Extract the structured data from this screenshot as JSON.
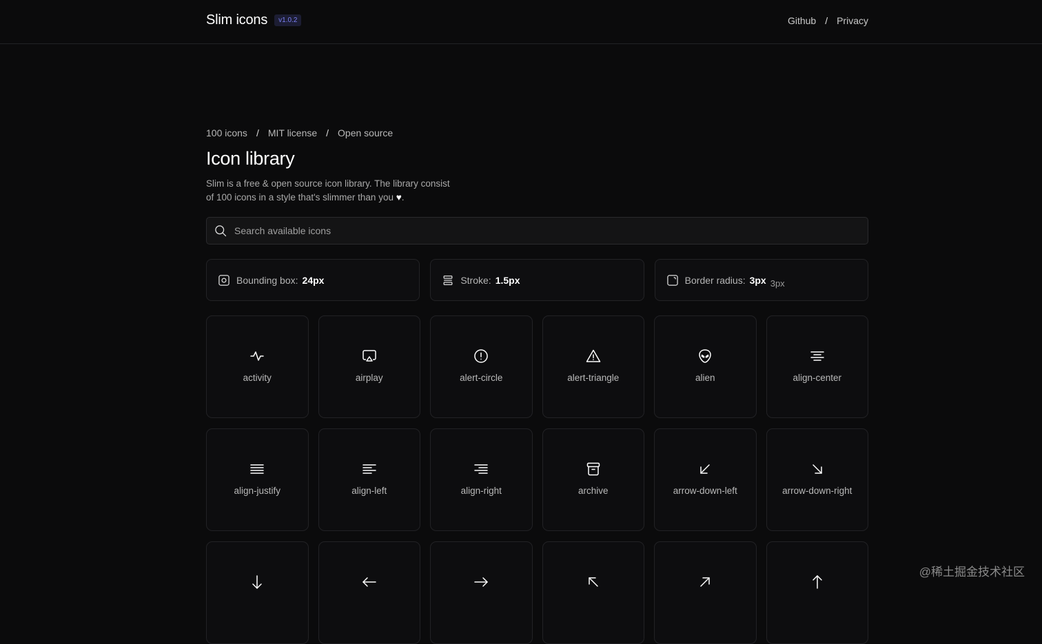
{
  "header": {
    "brand": "Slim icons",
    "version": "v1.0.2",
    "nav": [
      {
        "label": "Github"
      },
      {
        "label": "Privacy"
      }
    ],
    "separator": "/"
  },
  "meta": [
    "100 icons",
    "MIT license",
    "Open source"
  ],
  "title": "Icon library",
  "description_line1": "Slim is a free & open source icon library. The library consist",
  "description_line2": "of 100 icons in a style that's slimmer than you",
  "description_heart": "♥",
  "description_end": ".",
  "search": {
    "placeholder": "Search available icons",
    "value": ""
  },
  "settings": [
    {
      "label": "Bounding box:",
      "value": "24px",
      "extra": "",
      "icon": "bounding-box-icon"
    },
    {
      "label": "Stroke:",
      "value": "1.5px",
      "extra": "",
      "icon": "stroke-icon"
    },
    {
      "label": "Border radius:",
      "value": "3px",
      "extra": "3px",
      "icon": "border-radius-icon"
    }
  ],
  "icons": [
    {
      "label": "activity",
      "icon": "activity-icon"
    },
    {
      "label": "airplay",
      "icon": "airplay-icon"
    },
    {
      "label": "alert-circle",
      "icon": "alert-circle-icon"
    },
    {
      "label": "alert-triangle",
      "icon": "alert-triangle-icon"
    },
    {
      "label": "alien",
      "icon": "alien-icon"
    },
    {
      "label": "align-center",
      "icon": "align-center-icon"
    },
    {
      "label": "align-justify",
      "icon": "align-justify-icon"
    },
    {
      "label": "align-left",
      "icon": "align-left-icon"
    },
    {
      "label": "align-right",
      "icon": "align-right-icon"
    },
    {
      "label": "archive",
      "icon": "archive-icon"
    },
    {
      "label": "arrow-down-left",
      "icon": "arrow-down-left-icon"
    },
    {
      "label": "arrow-down-right",
      "icon": "arrow-down-right-icon"
    },
    {
      "label": "",
      "icon": "arrow-down-icon"
    },
    {
      "label": "",
      "icon": "arrow-left-icon"
    },
    {
      "label": "",
      "icon": "arrow-right-icon"
    },
    {
      "label": "",
      "icon": "arrow-up-left-icon"
    },
    {
      "label": "",
      "icon": "arrow-up-right-icon"
    },
    {
      "label": "",
      "icon": "arrow-up-icon"
    }
  ],
  "watermark": "@稀土掘金技术社区",
  "colors": {
    "background": "#0b0b0c",
    "version_badge": "#7a7ff2",
    "tile_border": "#222225"
  }
}
